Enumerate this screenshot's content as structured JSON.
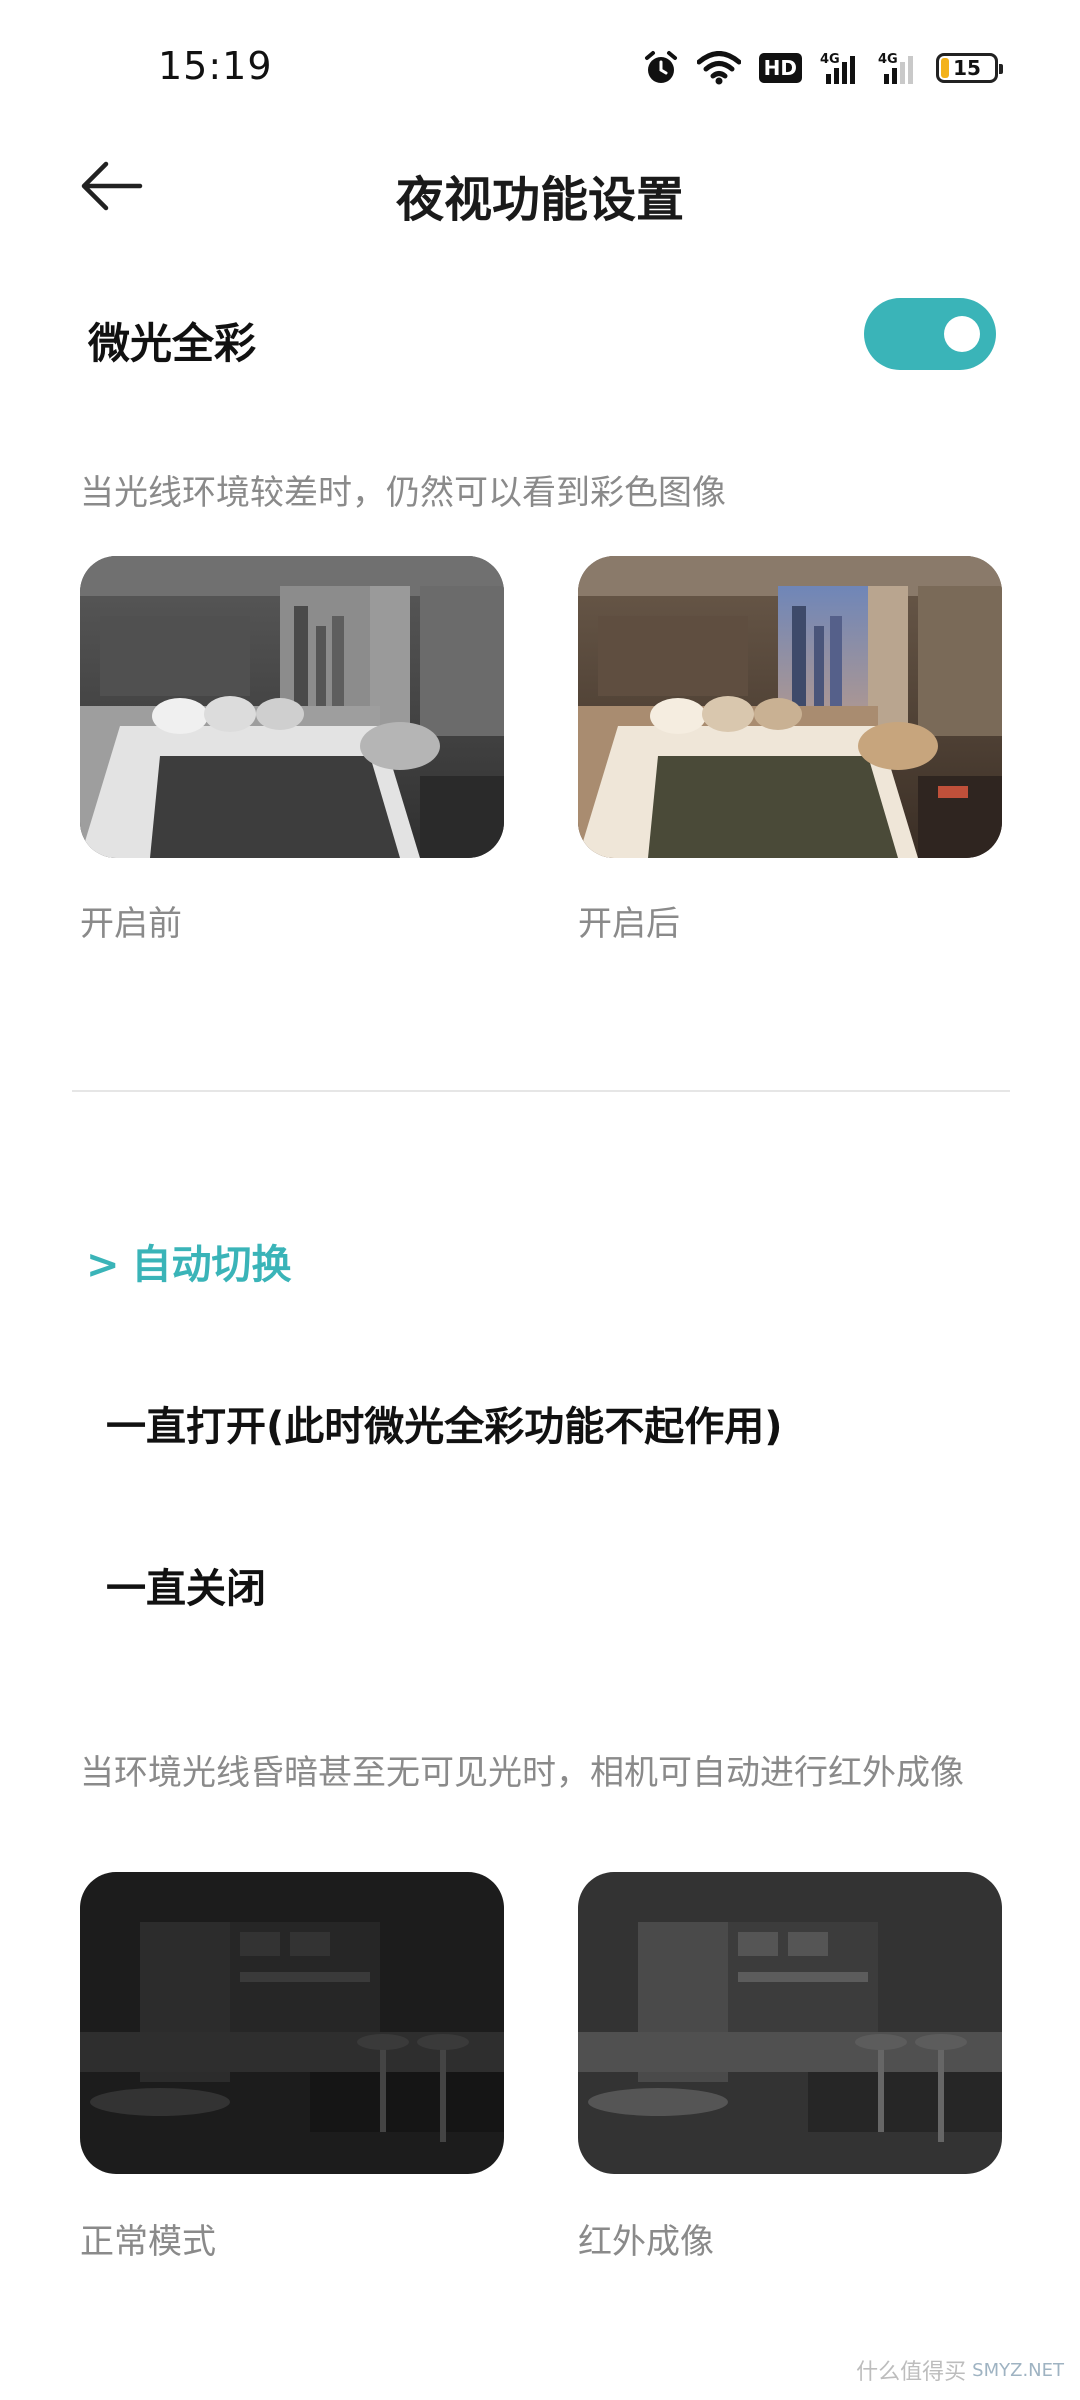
{
  "status_bar": {
    "time": "15:19",
    "icons": [
      "alarm-icon",
      "wifi-icon",
      "hd-icon",
      "signal-4g-icon",
      "signal-4g-icon",
      "battery-icon"
    ],
    "hd_label": "HD",
    "network_1": "4G",
    "network_2": "4G",
    "battery_level": "15",
    "battery_fraction": 0.15
  },
  "header": {
    "back_icon": "arrow-left-icon",
    "title": "夜视功能设置"
  },
  "low_light": {
    "label": "微光全彩",
    "enabled": true,
    "description": "当光线环境较差时，仍然可以看到彩色图像",
    "before_caption": "开启前",
    "after_caption": "开启后"
  },
  "options": {
    "items": [
      {
        "label": "自动切换",
        "selected": true,
        "marker": ">"
      },
      {
        "label": "一直打开(此时微光全彩功能不起作用)",
        "selected": false
      },
      {
        "label": "一直关闭",
        "selected": false
      }
    ],
    "description": "当环境光线昏暗甚至无可见光时，相机可自动进行红外成像",
    "normal_caption": "正常模式",
    "infrared_caption": "红外成像"
  },
  "watermark": {
    "text": "什么值得买",
    "sub": "SMYZ.NET"
  },
  "colors": {
    "accent": "#3ab4b8",
    "muted_text": "#8a8a8a",
    "divider": "#e6e6e6"
  }
}
